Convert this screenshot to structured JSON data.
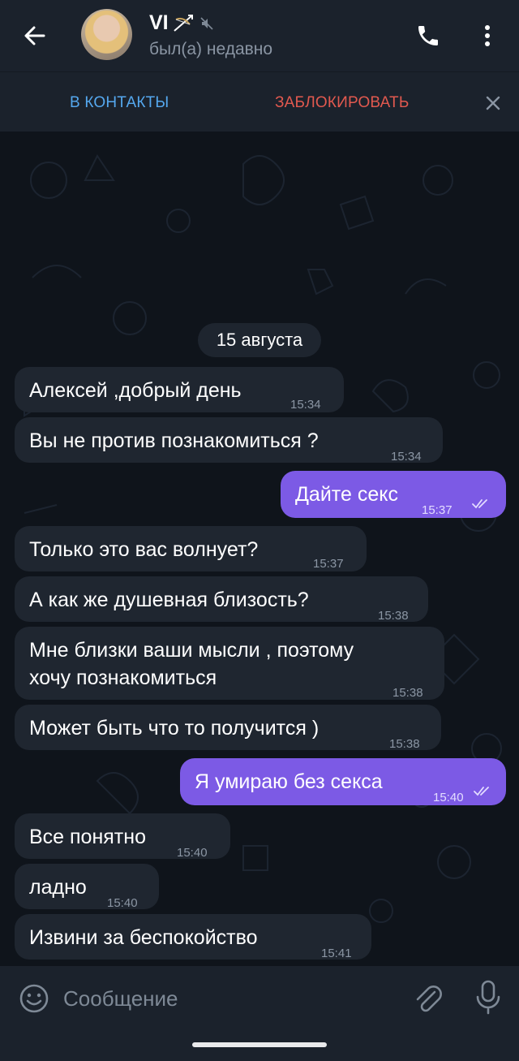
{
  "header": {
    "contact_name": "VI",
    "status": "был(а) недавно",
    "icons": [
      "arrow-left-icon",
      "bow-and-arrow-icon",
      "muted-icon",
      "phone-icon",
      "more-vertical-icon"
    ]
  },
  "action_bar": {
    "add_contact": "В КОНТАКТЫ",
    "block": "ЗАБЛОКИРОВАТЬ"
  },
  "chat": {
    "date": "15 августа",
    "messages": [
      {
        "direction": "in",
        "text": "Алексей ,добрый день",
        "time": "15:34"
      },
      {
        "direction": "in",
        "text": "Вы не против познакомиться ?",
        "time": "15:34"
      },
      {
        "direction": "out",
        "text": "Дайте секс",
        "time": "15:37",
        "read": true
      },
      {
        "direction": "in",
        "text": "Только это вас волнует?",
        "time": "15:37"
      },
      {
        "direction": "in",
        "text": "А как же душевная близость?",
        "time": "15:38"
      },
      {
        "direction": "in",
        "text": "Мне близки ваши мысли , поэтому\nхочу познакомиться",
        "time": "15:38"
      },
      {
        "direction": "in",
        "text": "Может быть что то получится )",
        "time": "15:38"
      },
      {
        "direction": "out",
        "text": "Я умираю без секса",
        "time": "15:40",
        "read": true
      },
      {
        "direction": "in",
        "text": "Все понятно",
        "time": "15:40"
      },
      {
        "direction": "in",
        "text": "ладно",
        "time": "15:40"
      },
      {
        "direction": "in",
        "text": "Извини за беспокойство",
        "time": "15:41"
      }
    ]
  },
  "composer": {
    "placeholder": "Сообщение",
    "value": ""
  },
  "colors": {
    "header_bg": "#1b222c",
    "chat_bg": "#0f141b",
    "incoming_bubble": "#1f2630",
    "outgoing_bubble": "#7c5ae5",
    "link_blue": "#55a8ef",
    "block_red": "#e2594f"
  }
}
